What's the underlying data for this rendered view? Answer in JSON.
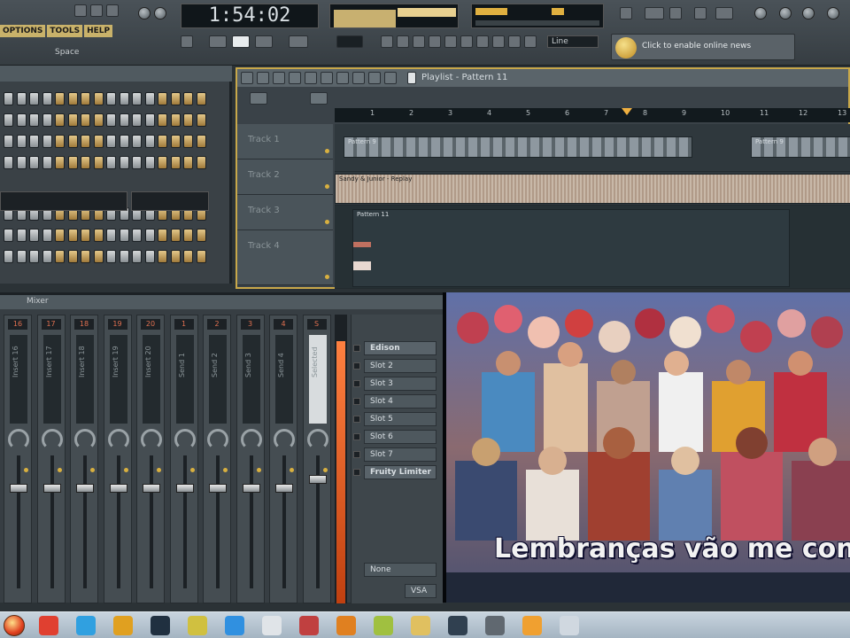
{
  "toolbar": {
    "menu": [
      "OPTIONS",
      "TOOLS",
      "HELP"
    ],
    "hint_text": "Space",
    "song_time": "1:54:02",
    "pattern_combo": "Line",
    "online_news": "Click to enable online news"
  },
  "step_sequencer": {
    "title": ""
  },
  "playlist": {
    "title": "Playlist - Pattern 11",
    "ruler": [
      "1",
      "2",
      "3",
      "4",
      "5",
      "6",
      "7",
      "8",
      "9",
      "10",
      "11",
      "12",
      "13"
    ],
    "tracks": [
      "Track 1",
      "Track 2",
      "Track 3",
      "Track 4"
    ],
    "clips": {
      "pattern_a": "Pattern 9",
      "pattern_b": "Pattern 9",
      "audio": "Sandy & Junior - Replay",
      "pattern_c": "Pattern 11"
    }
  },
  "mixer": {
    "title": "Mixer",
    "strips": [
      {
        "num": "16",
        "label": "Insert 16"
      },
      {
        "num": "17",
        "label": "Insert 17"
      },
      {
        "num": "18",
        "label": "Insert 18"
      },
      {
        "num": "19",
        "label": "Insert 19"
      },
      {
        "num": "20",
        "label": "Insert 20"
      },
      {
        "num": "1",
        "label": "Send 1"
      },
      {
        "num": "2",
        "label": "Send 2"
      },
      {
        "num": "3",
        "label": "Send 3"
      },
      {
        "num": "4",
        "label": "Send 4"
      },
      {
        "num": "S",
        "label": "Selected"
      }
    ],
    "fx_slots": [
      "Edison",
      "Slot 2",
      "Slot 3",
      "Slot 4",
      "Slot 5",
      "Slot 6",
      "Slot 7",
      "Fruity Limiter"
    ],
    "fx_footer": "None",
    "fx_bottom": "VSA"
  },
  "video": {
    "subtitle": "Lembranças vão me con"
  },
  "taskbar": {
    "icons": [
      "chrome-icon",
      "skype-icon",
      "media-icon",
      "monitor-icon",
      "fl-studio-icon",
      "ie-icon",
      "clock-icon",
      "acrobat-icon",
      "vlc-icon",
      "paint-icon",
      "folder-icon",
      "game-icon",
      "settings-icon",
      "star-icon",
      "network-icon"
    ]
  }
}
